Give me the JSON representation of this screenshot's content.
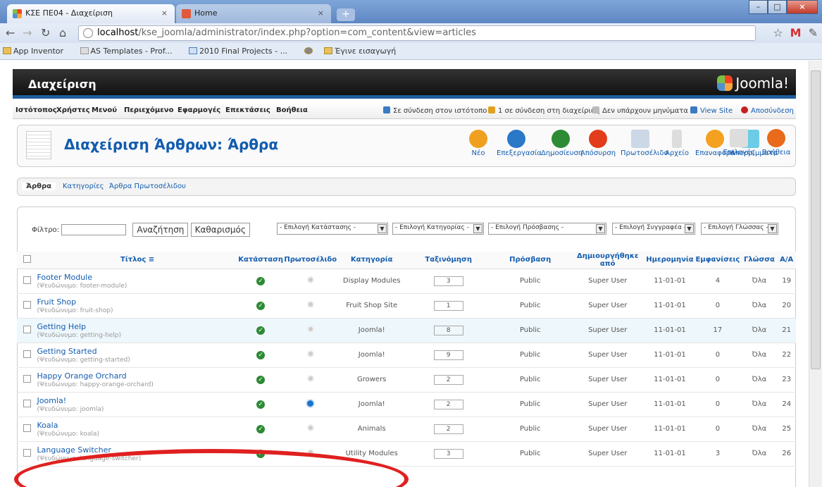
{
  "browser": {
    "tabs": [
      {
        "label": "ΚΣΕ ΠΕ04 - Διαχείριση",
        "active": true
      },
      {
        "label": "Home",
        "active": false
      }
    ],
    "url_host": "localhost",
    "url_path": "/kse_joomla/administrator/index.php?option=com_content&view=articles",
    "bookmarks": [
      "App Inventor",
      "AS Templates - Prof...",
      "2010 Final Projects - ...",
      "Έγινε εισαγωγή"
    ]
  },
  "header": {
    "title": "Διαχείριση",
    "brand": "Joomla!"
  },
  "menu": {
    "items": [
      "Ιστότοπος",
      "Χρήστες",
      "Μενού",
      "Περιεχόμενο",
      "Εφαρμογές",
      "Επεκτάσεις",
      "Βοήθεια"
    ],
    "status": [
      "Σε σύνδεση στον ιστότοπο",
      "1 σε σύνδεση στη διαχείριση",
      "Δεν υπάρχουν μηνύματα",
      "View Site",
      "Αποσύνδεση"
    ]
  },
  "page": {
    "title": "Διαχείριση Άρθρων: Άρθρα"
  },
  "toolbar": [
    "Νέο",
    "Επεξεργασία",
    "Δημοσίευση",
    "Απόσυρση",
    "Πρωτοσέλιδο",
    "Αρχείο",
    "Επαναφορά",
    "Απορρίμματα",
    "Επιλογές",
    "Βοήθεια"
  ],
  "subtabs": [
    "Άρθρα",
    "Κατηγορίες",
    "Άρθρα Πρωτοσέλιδου"
  ],
  "filter": {
    "label": "Φίλτρο:",
    "search": "Αναζήτηση",
    "clear": "Καθαρισμός",
    "selects": [
      "- Επιλογή Κατάστασης -",
      "- Επιλογή Κατηγορίας -",
      "- Επιλογή Πρόσβασης -",
      "- Επιλογή Συγγραφέα -",
      "- Επιλογή Γλώσσας -"
    ]
  },
  "columns": [
    "Τίτλος",
    "Κατάσταση",
    "Πρωτοσέλιδο",
    "Κατηγορία",
    "Ταξινόμηση",
    "Πρόσβαση",
    "Δημιουργήθηκε από",
    "Ημερομηνία",
    "Εμφανίσεις",
    "Γλώσσα",
    "Α/Α"
  ],
  "rows": [
    {
      "title": "Footer Module",
      "alias": "(Ψευδώνυμο: footer-module)",
      "featured": false,
      "category": "Display Modules",
      "order": "3",
      "access": "Public",
      "author": "Super User",
      "date": "11-01-01",
      "hits": "4",
      "lang": "Όλα",
      "id": "19"
    },
    {
      "title": "Fruit Shop",
      "alias": "(Ψευδώνυμο: fruit-shop)",
      "featured": false,
      "category": "Fruit Shop Site",
      "order": "1",
      "access": "Public",
      "author": "Super User",
      "date": "11-01-01",
      "hits": "0",
      "lang": "Όλα",
      "id": "20"
    },
    {
      "title": "Getting Help",
      "alias": "(Ψευδώνυμο: getting-help)",
      "featured": false,
      "category": "Joomla!",
      "order": "8",
      "access": "Public",
      "author": "Super User",
      "date": "11-01-01",
      "hits": "17",
      "lang": "Όλα",
      "id": "21"
    },
    {
      "title": "Getting Started",
      "alias": "(Ψευδώνυμο: getting-started)",
      "featured": false,
      "category": "Joomla!",
      "order": "9",
      "access": "Public",
      "author": "Super User",
      "date": "11-01-01",
      "hits": "0",
      "lang": "Όλα",
      "id": "22"
    },
    {
      "title": "Happy Orange Orchard",
      "alias": "(Ψευδώνυμο: happy-orange-orchard)",
      "featured": false,
      "category": "Growers",
      "order": "2",
      "access": "Public",
      "author": "Super User",
      "date": "11-01-01",
      "hits": "0",
      "lang": "Όλα",
      "id": "23"
    },
    {
      "title": "Joomla!",
      "alias": "(Ψευδώνυμο: joomla)",
      "featured": true,
      "category": "Joomla!",
      "order": "2",
      "access": "Public",
      "author": "Super User",
      "date": "11-01-01",
      "hits": "0",
      "lang": "Όλα",
      "id": "24"
    },
    {
      "title": "Koala",
      "alias": "(Ψευδώνυμο: koala)",
      "featured": false,
      "category": "Animals",
      "order": "2",
      "access": "Public",
      "author": "Super User",
      "date": "11-01-01",
      "hits": "0",
      "lang": "Όλα",
      "id": "25"
    },
    {
      "title": "Language Switcher",
      "alias": "(Ψευδώνυμο: language-switcher)",
      "featured": false,
      "category": "Utility Modules",
      "order": "3",
      "access": "Public",
      "author": "Super User",
      "date": "11-01-01",
      "hits": "3",
      "lang": "Όλα",
      "id": "26"
    }
  ],
  "colors": {
    "link": "#135cae",
    "header_bg": "#1a1a1a",
    "accent_bar": "#1f5d9a",
    "annotation": "#e02020"
  }
}
